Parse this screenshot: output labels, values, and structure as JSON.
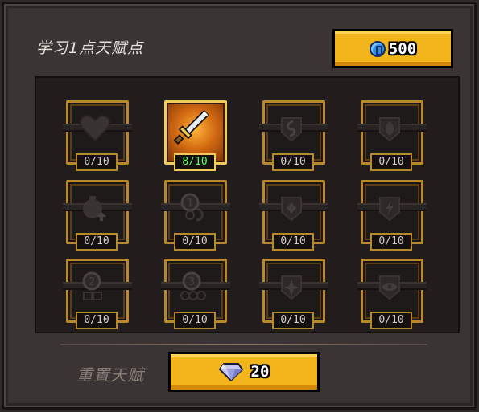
{
  "header": {
    "title": "学习1点天赋点",
    "coins": "500"
  },
  "colors": {
    "accent": "#f3b51c",
    "active_count": "#5cff5c",
    "frame_gold": "#b8892c"
  },
  "talents": [
    {
      "icon": "heart-icon",
      "count": "0/10",
      "active": false
    },
    {
      "icon": "sword-icon",
      "count": "8/10",
      "active": true
    },
    {
      "icon": "swirl-icon",
      "count": "0/10",
      "active": false
    },
    {
      "icon": "flame-icon",
      "count": "0/10",
      "active": false
    },
    {
      "icon": "potion-upgrade-icon",
      "count": "0/10",
      "active": false
    },
    {
      "icon": "coin-one-icon",
      "count": "0/10",
      "active": false
    },
    {
      "icon": "diamond-shield-icon",
      "count": "0/10",
      "active": false
    },
    {
      "icon": "lightning-shield-icon",
      "count": "0/10",
      "active": false
    },
    {
      "icon": "coin-two-icon",
      "count": "0/10",
      "active": false
    },
    {
      "icon": "coin-three-icon",
      "count": "0/10",
      "active": false
    },
    {
      "icon": "spiky-shield-icon",
      "count": "0/10",
      "active": false
    },
    {
      "icon": "eye-shield-icon",
      "count": "0/10",
      "active": false
    }
  ],
  "footer": {
    "reset_label": "重置天赋",
    "gems": "20"
  }
}
